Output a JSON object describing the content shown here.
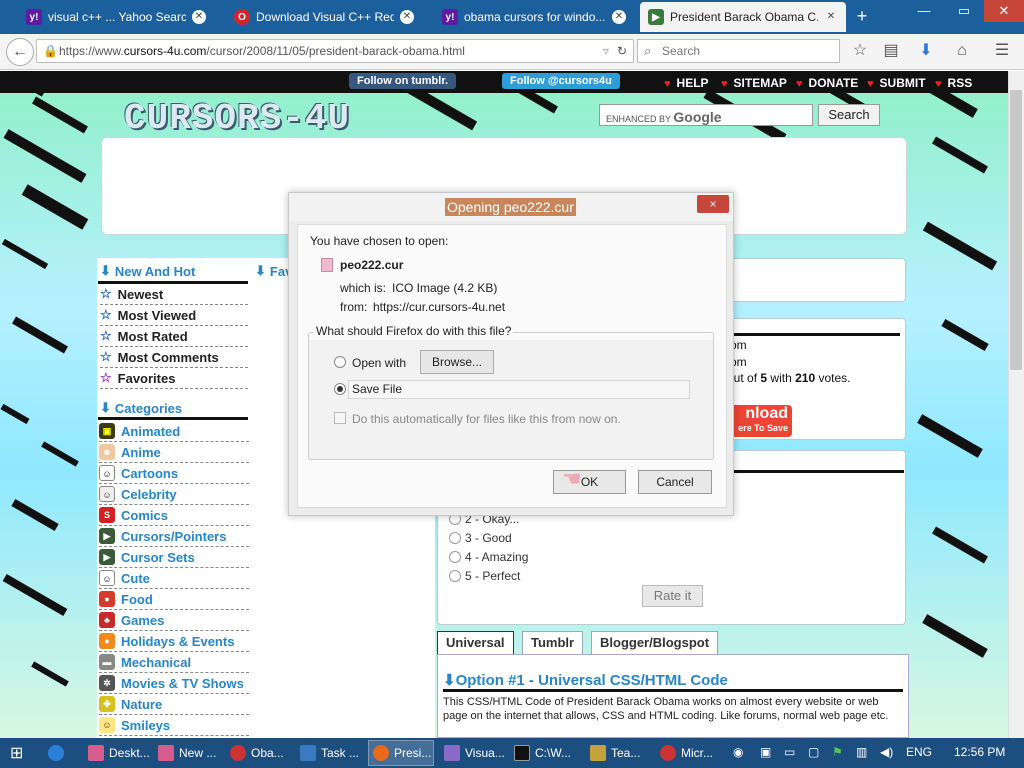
{
  "browser": {
    "tabs": [
      {
        "label": "visual c++ ... Yahoo Search",
        "icon": "yahoo-icon",
        "color": "#5c1aa6"
      },
      {
        "label": "Download Visual C++ Red...",
        "icon": "opera-icon",
        "color": "#d8232a"
      },
      {
        "label": "obama cursors for windo...",
        "icon": "yahoo-icon",
        "color": "#5c1aa6"
      },
      {
        "label": "President Barack Obama C...",
        "icon": "cursors-site-icon",
        "color": "#3a7a3a"
      }
    ],
    "url_prefix": "https://www.",
    "url_domain": "cursors-4u.com",
    "url_path": "/cursor/2008/11/05/president-barack-obama.html",
    "search_placeholder": "Search"
  },
  "site": {
    "tumblr_pill": "Follow on tumblr.",
    "twitter_pill": "Follow @cursors4u",
    "top_links": [
      "HELP",
      "SITEMAP",
      "DONATE",
      "SUBMIT",
      "RSS"
    ],
    "logo_text": "CURSORS-4U",
    "google_enhanced": "ENHANCED BY",
    "google_word": "Google",
    "search_button": "Search",
    "new_and_hot": "New And Hot",
    "fav_heading": "Fav",
    "nav_links": [
      "Newest",
      "Most Viewed",
      "Most Rated",
      "Most Comments",
      "Favorites"
    ],
    "categories_heading": "Categories",
    "categories": [
      "Animated",
      "Anime",
      "Cartoons",
      "Celebrity",
      "Comics",
      "Cursors/Pointers",
      "Cursor Sets",
      "Cute",
      "Food",
      "Games",
      "Holidays & Events",
      "Mechanical",
      "Movies & TV Shows",
      "Nature",
      "Smileys"
    ],
    "right_lines": [
      "om",
      "om"
    ],
    "rating_prefix": "out of",
    "rating_max": "5",
    "rating_with": "with",
    "rating_votes": "210",
    "rating_suffix": "votes.",
    "download_label": "nload",
    "download_sub": "ere To Save",
    "rate_options": [
      "2 - Okay...",
      "3 - Good",
      "4 - Amazing",
      "5 - Perfect"
    ],
    "rate_button": "Rate it",
    "code_tabs": [
      "Universal",
      "Tumblr",
      "Blogger/Blogspot"
    ],
    "option_heading": "Option #1 - Universal CSS/HTML Code",
    "option_desc": "This CSS/HTML Code of President Barack Obama works on almost every website or web page on the internet that allows, CSS and HTML coding. Like forums, normal web page etc."
  },
  "dialog": {
    "title": "Opening peo222.cur",
    "close": "×",
    "chosen_label": "You have chosen to open:",
    "file_name": "peo222.cur",
    "which_is_label": "which is:",
    "which_is_value": "ICO Image (4.2 KB)",
    "from_label": "from:",
    "from_value": "https://cur.cursors-4u.net",
    "question": "What should Firefox do with this file?",
    "open_with": "Open with",
    "browse_button": "Browse...",
    "save_file": "Save File",
    "auto_checkbox": "Do this automatically for files like this from now on.",
    "ok_button": "OK",
    "cancel_button": "Cancel"
  },
  "taskbar": {
    "items": [
      "Deskt...",
      "New ...",
      "Oba...",
      "Task ...",
      "Presi...",
      "Visua...",
      "C:\\W...",
      "Tea...",
      "Micr..."
    ],
    "lang": "ENG",
    "time": "12:56 PM"
  }
}
